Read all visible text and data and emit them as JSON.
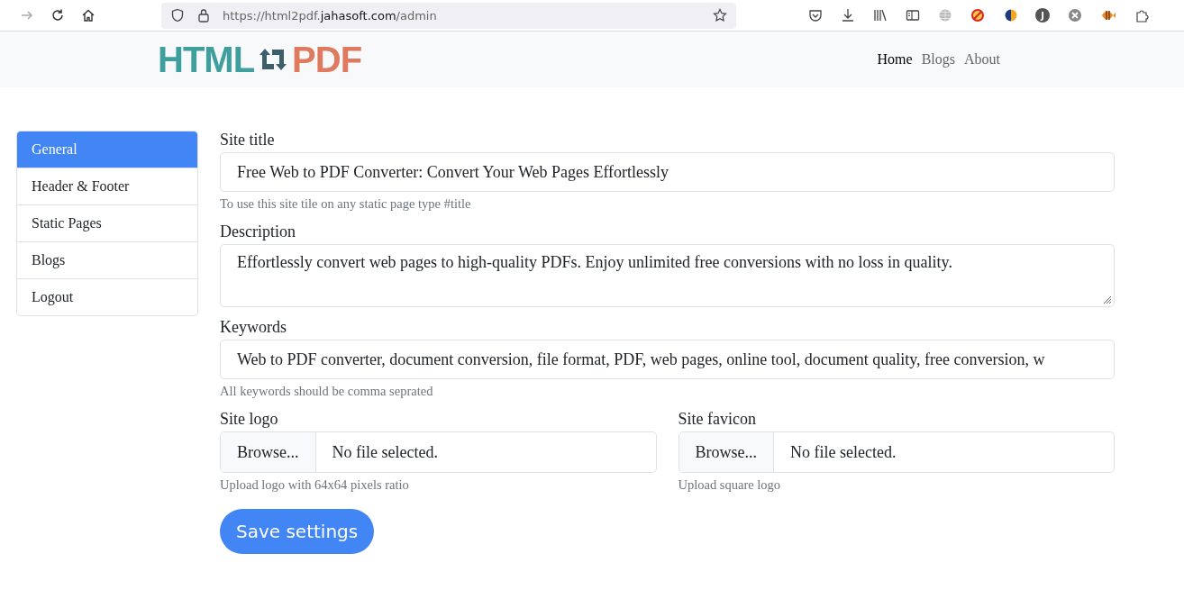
{
  "browser": {
    "url_prefix": "https://html2pdf.",
    "url_domain": "jahasoft.com",
    "url_path": "/admin",
    "profile_initial": "J"
  },
  "navbar": {
    "logo_left": "HTML",
    "logo_right": "PDF",
    "links": [
      {
        "label": "Home",
        "selected": true
      },
      {
        "label": "Blogs",
        "selected": false
      },
      {
        "label": "About",
        "selected": false
      }
    ]
  },
  "sidebar": {
    "items": [
      {
        "label": "General",
        "selected": true
      },
      {
        "label": "Header & Footer",
        "selected": false
      },
      {
        "label": "Static Pages",
        "selected": false
      },
      {
        "label": "Blogs",
        "selected": false
      },
      {
        "label": "Logout",
        "selected": false
      }
    ]
  },
  "form": {
    "fields": [
      {
        "kind": "text",
        "label": "Site title",
        "value": "Free Web to PDF Converter: Convert Your Web Pages Effortlessly",
        "help": "To use this site tile on any static page type #title"
      },
      {
        "kind": "textarea",
        "label": "Description",
        "value": "Effortlessly convert web pages to high-quality PDFs. Enjoy unlimited free conversions with no loss in quality."
      },
      {
        "kind": "text",
        "label": "Keywords",
        "value": "Web to PDF converter, document conversion, file format, PDF, web pages, online tool, document quality, free conversion, w",
        "help": "All keywords should be comma seprated"
      }
    ],
    "uploads": [
      {
        "label": "Site logo",
        "button": "Browse...",
        "status": "No file selected.",
        "help": "Upload logo with 64x64 pixels ratio"
      },
      {
        "label": "Site favicon",
        "button": "Browse...",
        "status": "No file selected.",
        "help": "Upload square logo"
      }
    ],
    "submit": "Save settings"
  }
}
